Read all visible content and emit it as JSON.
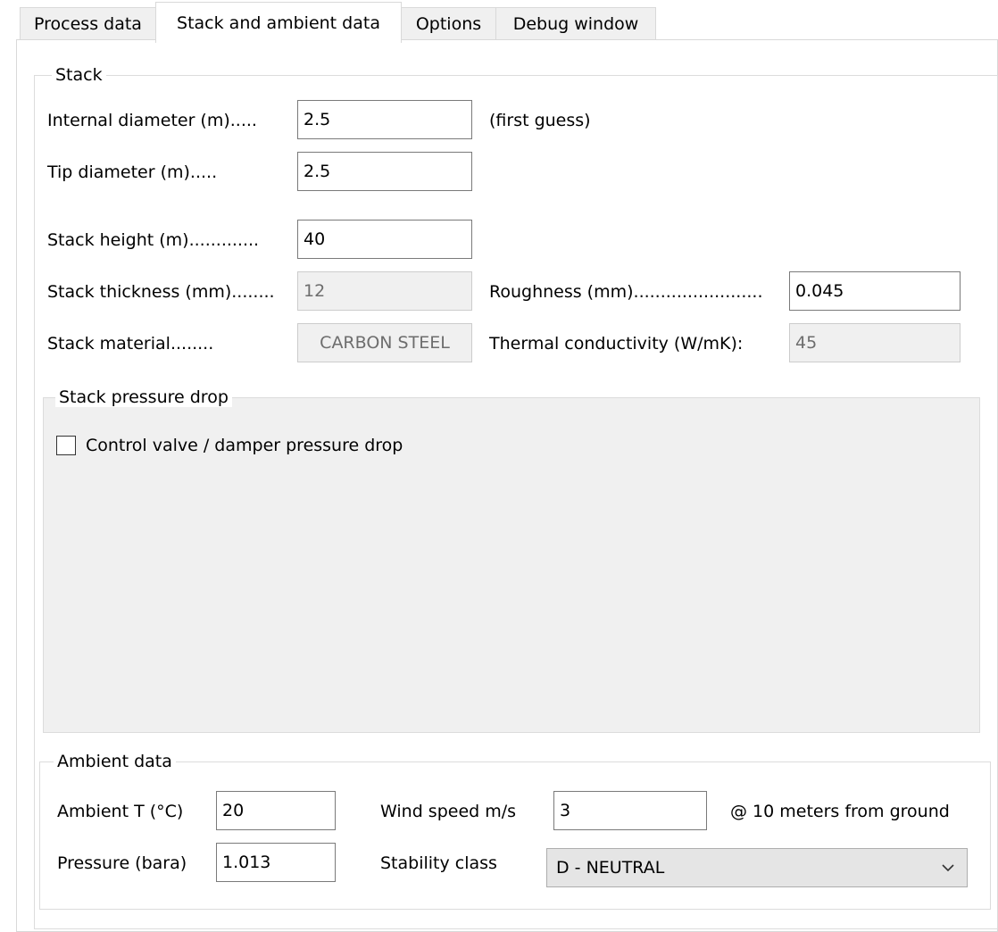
{
  "tabs": [
    "Process data",
    "Stack and ambient data",
    "Options",
    "Debug window"
  ],
  "stack": {
    "title": "Stack",
    "internal_diameter": {
      "label": "Internal diameter (m).....",
      "value": "2.5",
      "note": "(first guess)"
    },
    "tip_diameter": {
      "label": "Tip diameter (m).....",
      "value": "2.5"
    },
    "stack_height": {
      "label": "Stack height (m).............",
      "value": "40"
    },
    "stack_thickness": {
      "label": "Stack thickness (mm)........",
      "value": "12"
    },
    "roughness": {
      "label": "Roughness (mm)........................",
      "value": "0.045"
    },
    "stack_material": {
      "label": "Stack material........",
      "value": "CARBON STEEL"
    },
    "thermal_conductivity": {
      "label": "Thermal conductivity (W/mK):",
      "value": "45"
    }
  },
  "pressure_drop": {
    "title": "Stack pressure drop",
    "control_valve_label": "Control valve / damper pressure drop",
    "control_valve_checked": false
  },
  "ambient": {
    "title": "Ambient data",
    "ambient_t": {
      "label": "Ambient T (°C)",
      "value": "20"
    },
    "wind_speed": {
      "label": "Wind speed m/s",
      "value": "3",
      "note": "@ 10 meters from ground"
    },
    "pressure": {
      "label": "Pressure (bara)",
      "value": "1.013"
    },
    "stability_class": {
      "label": "Stability class",
      "value": "D - NEUTRAL"
    }
  },
  "icons": {
    "dropdown": "chevron-down-icon"
  },
  "colors": {
    "border": "#7a7a7a",
    "disabled_bg": "#f0f0f0",
    "group_border": "#dcdcdc",
    "combo_bg": "#e5e5e5"
  }
}
